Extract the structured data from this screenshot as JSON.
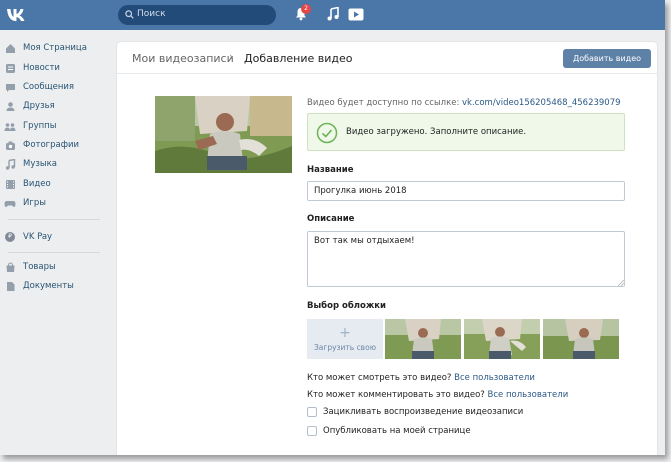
{
  "header": {
    "search_placeholder": "Поиск",
    "notification_count": "2"
  },
  "sidebar": {
    "items": [
      {
        "label": "Моя Страница",
        "icon": "home-icon"
      },
      {
        "label": "Новости",
        "icon": "news-icon"
      },
      {
        "label": "Сообщения",
        "icon": "messages-icon"
      },
      {
        "label": "Друзья",
        "icon": "friends-icon"
      },
      {
        "label": "Группы",
        "icon": "groups-icon"
      },
      {
        "label": "Фотографии",
        "icon": "camera-icon"
      },
      {
        "label": "Музыка",
        "icon": "music-icon"
      },
      {
        "label": "Видео",
        "icon": "video-icon"
      },
      {
        "label": "Игры",
        "icon": "games-icon"
      }
    ],
    "pay": {
      "label": "VK Pay",
      "icon": "vkpay-icon"
    },
    "extra": [
      {
        "label": "Товары",
        "icon": "market-icon"
      },
      {
        "label": "Документы",
        "icon": "documents-icon"
      }
    ]
  },
  "page": {
    "breadcrumb_parent": "Мои видеозаписи",
    "breadcrumb_current": "Добавление видео",
    "add_button": "Добавить видео"
  },
  "upload": {
    "link_prefix": "Видео будет доступно по ссылке:",
    "link": "vk.com/video156205468_456239079",
    "success_message": "Видео загружено. Заполните описание.",
    "name_label": "Название",
    "name_value": "Прогулка июнь 2018",
    "description_label": "Описание",
    "description_value": "Вот так мы отдыхаем!",
    "cover_label": "Выбор обложки",
    "cover_upload": "Загрузить свою",
    "view_question": "Кто может смотреть это видео?",
    "view_value": "Все пользователи",
    "comment_question": "Кто может комментировать это видео?",
    "comment_value": "Все пользователи",
    "loop_label": "Зацикливать воспроизведение видеозаписи",
    "publish_label": "Опубликовать на моей странице"
  },
  "colors": {
    "header": "#4a76a8",
    "link": "#2a5885",
    "button": "#5e81a8",
    "success_bg": "#f0f8ea"
  }
}
